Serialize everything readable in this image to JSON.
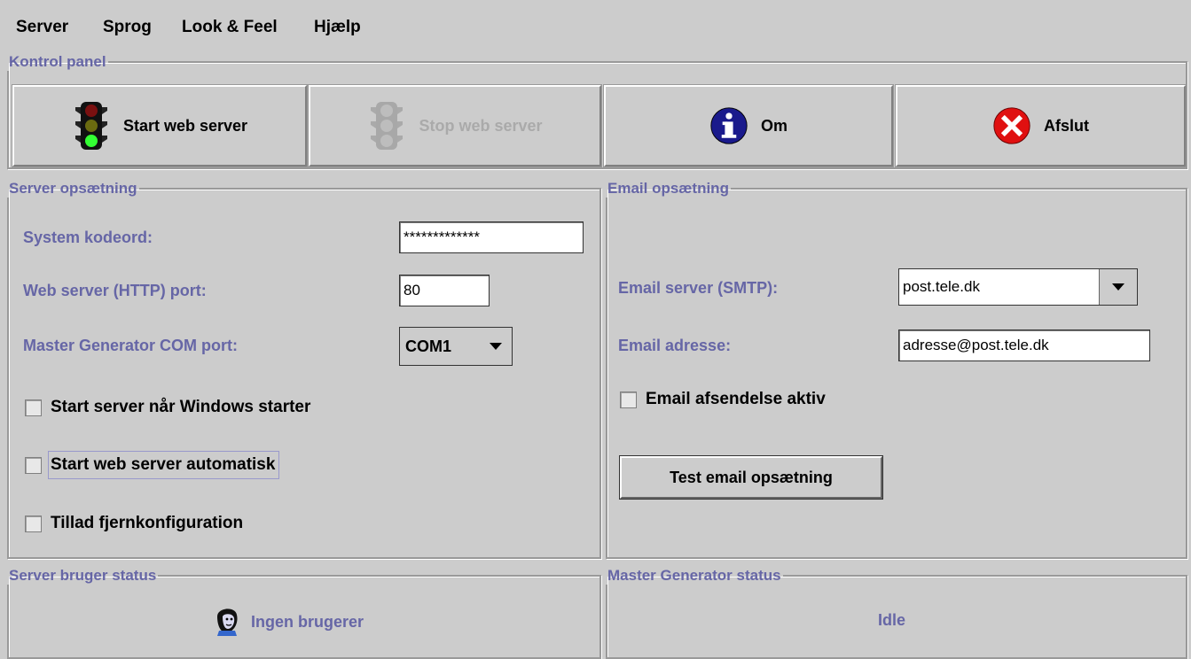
{
  "menu": {
    "server": "Server",
    "sprog": "Sprog",
    "look_feel": "Look & Feel",
    "hjaelp": "Hjælp"
  },
  "control_panel": {
    "title": "Kontrol panel",
    "start_label": "Start web server",
    "stop_label": "Stop web server",
    "about_label": "Om",
    "exit_label": "Afslut"
  },
  "server_setup": {
    "title": "Server opsætning",
    "password_label": "System kodeord:",
    "password_value": "*************",
    "port_label": "Web server (HTTP) port:",
    "port_value": "80",
    "com_label": "Master Generator COM port:",
    "com_value": "COM1",
    "check_start_windows": "Start server når Windows starter",
    "check_auto_start": "Start web server automatisk",
    "check_remote": "Tillad fjernkonfiguration"
  },
  "email_setup": {
    "title": "Email opsætning",
    "smtp_label": "Email server (SMTP):",
    "smtp_value": "post.tele.dk",
    "address_label": "Email adresse:",
    "address_value": "adresse@post.tele.dk",
    "check_active": "Email afsendelse aktiv",
    "test_button": "Test email opsætning"
  },
  "user_status": {
    "title": "Server bruger status",
    "text": "Ingen brugerer"
  },
  "generator_status": {
    "title": "Master Generator status",
    "text": "Idle"
  },
  "colors": {
    "background": "#cccccc",
    "label": "#6666a6",
    "info_blue": "#1a1a8c",
    "error_red": "#e01010"
  }
}
